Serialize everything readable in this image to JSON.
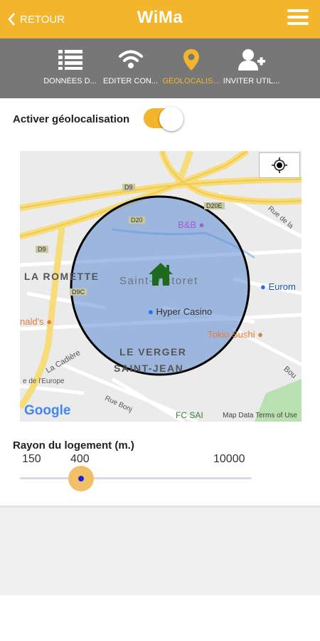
{
  "header": {
    "back_label": "RETOUR",
    "logo": "WiMa",
    "accent_color": "#f3b52b",
    "menu_icon": "hamburger-menu-icon"
  },
  "tabs": [
    {
      "label": "DONNÉES D...",
      "icon": "list-icon",
      "active": false
    },
    {
      "label": "EDITER CON...",
      "icon": "wifi-icon",
      "active": false
    },
    {
      "label": "GÉOLOCALIS...",
      "icon": "location-pin-icon",
      "active": true
    },
    {
      "label": "INVITER UTIL...",
      "icon": "add-user-icon",
      "active": false
    }
  ],
  "geolocation": {
    "label": "Activer géolocalisation",
    "enabled": true
  },
  "map": {
    "labels": {
      "la_romette": "LA ROMETTE",
      "saint_victoret": "Saint-Victoret",
      "le_verger": "LE VERGER",
      "saint_jean": "SAINT-JEAN",
      "hyper_casino": "Hyper Casino",
      "tokio_sushi": "Tokio Sushi",
      "euromaster": "Eurom",
      "bb": "B&B",
      "naldos": "nald's",
      "la_cadiere": "La Cadière",
      "rue_de_la": "Rue de la",
      "europe": "e de l'Europe",
      "rue_bonjour": "Rue Bonj",
      "bou": "Bou",
      "fc": "FC SAI",
      "d9": "D9",
      "d20": "D20",
      "d20e": "D20E",
      "d9c": "D9C",
      "d9b": "D9"
    },
    "google_text": "Google",
    "data_text": "Map Data  Terms of Use",
    "locate_icon": "crosshair-locate-icon",
    "home_icon": "house-icon"
  },
  "radius": {
    "title": "Rayon du logement (m.)",
    "min_label": "150",
    "value_label": "400",
    "max_label": "10000",
    "min": 150,
    "max": 10000,
    "value": 400,
    "thumb_fraction": 0.264
  }
}
